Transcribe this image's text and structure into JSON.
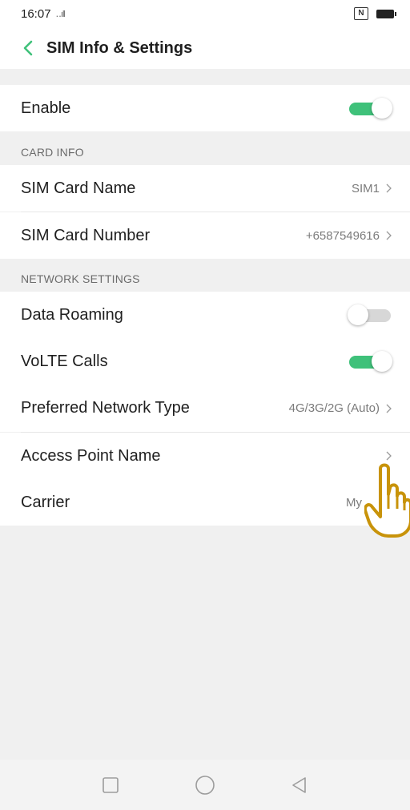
{
  "status_bar": {
    "time": "16:07",
    "signal_text": "‥ıll"
  },
  "header": {
    "title": "SIM Info & Settings",
    "back_icon": "chevron-left-icon",
    "accent": "#3fc17a"
  },
  "enable": {
    "label": "Enable",
    "state": true
  },
  "card_info": {
    "section_label": "CARD INFO",
    "sim_card_name": {
      "label": "SIM Card Name",
      "value": "SIM1"
    },
    "sim_card_number": {
      "label": "SIM Card Number",
      "value": "+6587549616"
    }
  },
  "network_settings": {
    "section_label": "NETWORK SETTINGS",
    "data_roaming": {
      "label": "Data Roaming",
      "state": false
    },
    "volte_calls": {
      "label": "VoLTE Calls",
      "state": true
    },
    "preferred_network_type": {
      "label": "Preferred Network Type",
      "value": "4G/3G/2G (Auto)"
    },
    "access_point_name": {
      "label": "Access Point Name",
      "value": ""
    },
    "carrier": {
      "label": "Carrier",
      "value": "My"
    }
  },
  "nav_bar": {
    "icons": [
      "square-recents-icon",
      "circle-home-icon",
      "triangle-back-icon"
    ]
  },
  "overlay": {
    "icon": "pointing-hand-cursor-icon",
    "color": "#c8930a"
  }
}
